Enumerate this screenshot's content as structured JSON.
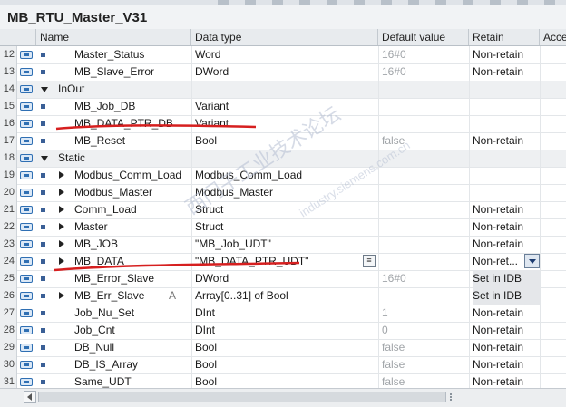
{
  "title": "MB_RTU_Master_V31",
  "headers": {
    "name": "Name",
    "type": "Data type",
    "default": "Default value",
    "retain": "Retain",
    "access": "Acce"
  },
  "rows": [
    {
      "num": "12",
      "kind": "item",
      "name": "Master_Status",
      "type": "Word",
      "default": "16#0",
      "retain": "Non-retain"
    },
    {
      "num": "13",
      "kind": "item",
      "name": "MB_Slave_Error",
      "type": "DWord",
      "default": "16#0",
      "retain": "Non-retain"
    },
    {
      "num": "14",
      "kind": "section",
      "name": "InOut",
      "type": "",
      "default": "",
      "retain": ""
    },
    {
      "num": "15",
      "kind": "item",
      "name": "MB_Job_DB",
      "type": "Variant",
      "default": "",
      "retain": ""
    },
    {
      "num": "16",
      "kind": "item",
      "name": "MB_DATA_PTR_DB",
      "type": "Variant",
      "default": "",
      "retain": ""
    },
    {
      "num": "17",
      "kind": "item",
      "name": "MB_Reset",
      "type": "Bool",
      "default": "false",
      "retain": "Non-retain"
    },
    {
      "num": "18",
      "kind": "section",
      "name": "Static",
      "type": "",
      "default": "",
      "retain": ""
    },
    {
      "num": "19",
      "kind": "struct",
      "name": "Modbus_Comm_Load",
      "type": "Modbus_Comm_Load",
      "default": "",
      "retain": ""
    },
    {
      "num": "20",
      "kind": "struct",
      "name": "Modbus_Master",
      "type": "Modbus_Master",
      "default": "",
      "retain": ""
    },
    {
      "num": "21",
      "kind": "struct",
      "name": "Comm_Load",
      "type": "Struct",
      "default": "",
      "retain": "Non-retain"
    },
    {
      "num": "22",
      "kind": "struct",
      "name": "Master",
      "type": "Struct",
      "default": "",
      "retain": "Non-retain"
    },
    {
      "num": "23",
      "kind": "struct",
      "name": "MB_JOB",
      "type": "\"MB_Job_UDT\"",
      "default": "",
      "retain": "Non-retain"
    },
    {
      "num": "24",
      "kind": "struct",
      "name": "MB_DATA",
      "type": "\"MB_DATA_PTR_UDT\"",
      "default": "",
      "retain": "Non-ret..."
    },
    {
      "num": "25",
      "kind": "item",
      "name": "MB_Error_Slave",
      "type": "DWord",
      "default": "16#0",
      "retain": "Set in IDB"
    },
    {
      "num": "26",
      "kind": "struct",
      "name": "MB_Err_Slave",
      "type": "Array[0..31] of Bool",
      "default": "",
      "retain": "Set in IDB"
    },
    {
      "num": "27",
      "kind": "item",
      "name": "Job_Nu_Set",
      "type": "DInt",
      "default": "1",
      "retain": "Non-retain"
    },
    {
      "num": "28",
      "kind": "item",
      "name": "Job_Cnt",
      "type": "DInt",
      "default": "0",
      "retain": "Non-retain"
    },
    {
      "num": "29",
      "kind": "item",
      "name": "DB_Null",
      "type": "Bool",
      "default": "false",
      "retain": "Non-retain"
    },
    {
      "num": "30",
      "kind": "item",
      "name": "DB_IS_Array",
      "type": "Bool",
      "default": "false",
      "retain": "Non-retain"
    },
    {
      "num": "31",
      "kind": "item",
      "name": "Same_UDT",
      "type": "Bool",
      "default": "false",
      "retain": "Non-retain"
    }
  ],
  "row26_extra": "A",
  "watermark": "西门子工业技术论坛",
  "watermark_sub": "industry.siemens.com.cn",
  "colors": {
    "accent": "#2f6fb3",
    "annotation": "#d61f1f"
  }
}
